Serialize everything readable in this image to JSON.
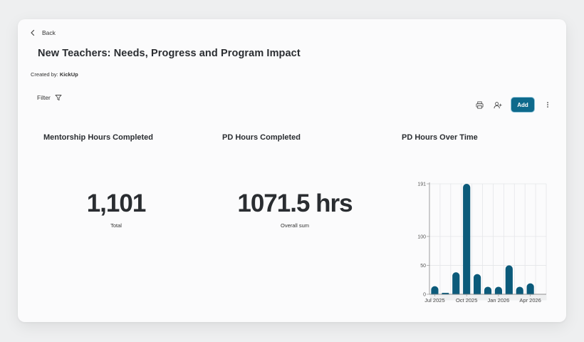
{
  "header": {
    "back_label": "Back",
    "title": "New Teachers: Needs, Progress and Program Impact",
    "created_by_label": "Created by:",
    "created_by_value": "KickUp",
    "filter_label": "Filter",
    "add_label": "Add"
  },
  "widgets": {
    "mentorship": {
      "title": "Mentorship Hours Completed",
      "value": "1,101",
      "caption": "Total"
    },
    "pd_hours": {
      "title": "PD Hours Completed",
      "value": "1071.5 hrs",
      "caption": "Overall sum"
    },
    "pd_over_time": {
      "title": "PD Hours Over Time"
    }
  },
  "colors": {
    "accent": "#0e6a8c",
    "bar": "#0b5a7a",
    "text": "#2a2d31"
  },
  "chart_data": {
    "type": "bar",
    "title": "PD Hours Over Time",
    "categories": [
      "Jul 2025",
      "Aug 2025",
      "Sep 2025",
      "Oct 2025",
      "Nov 2025",
      "Dec 2025",
      "Jan 2026",
      "Feb 2026",
      "Mar 2026",
      "Apr 2026",
      "May 2026"
    ],
    "values": [
      14,
      1,
      38,
      191,
      35,
      13,
      13,
      50,
      13,
      19,
      0
    ],
    "x_tick_labels": [
      "Jul 2025",
      "Oct 2025",
      "Jan 2026",
      "Apr 2026"
    ],
    "y_ticks": [
      0,
      50,
      100,
      191
    ],
    "ylim": [
      0,
      191
    ],
    "grid": true,
    "xlabel": "",
    "ylabel": ""
  }
}
